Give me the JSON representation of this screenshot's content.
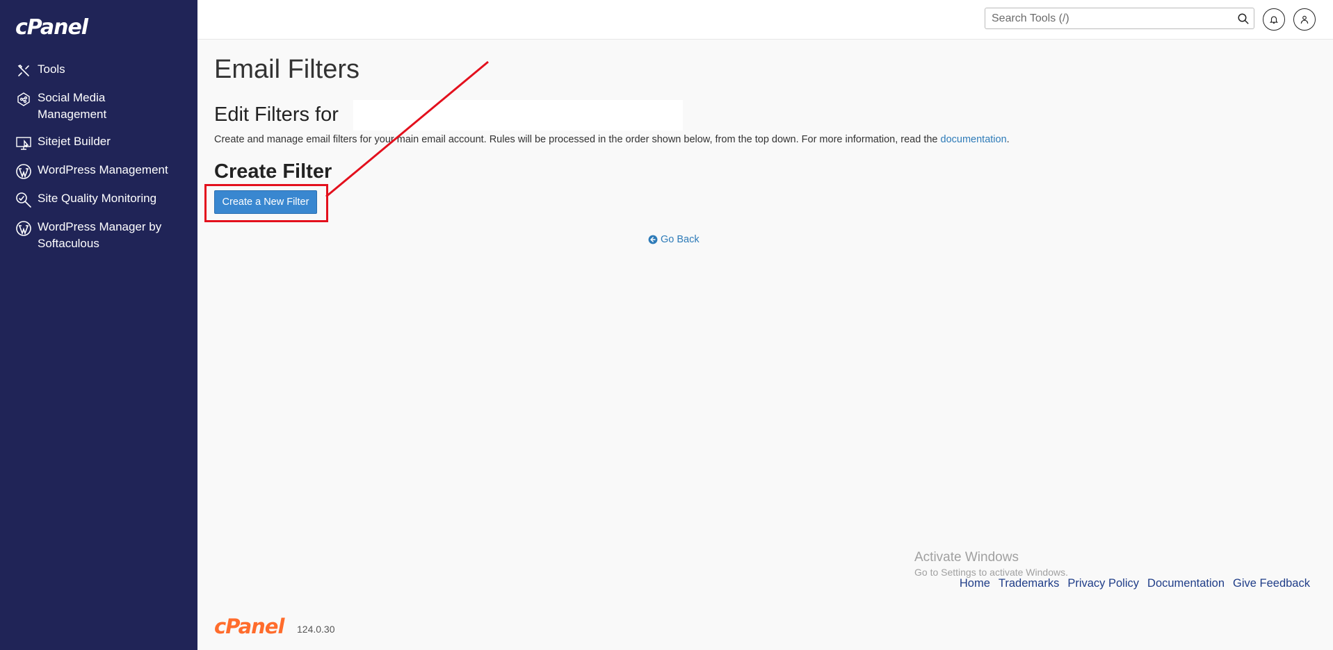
{
  "brand": {
    "logo_text": "cPanel",
    "version": "124.0.30"
  },
  "sidebar": {
    "items": [
      {
        "label": "Tools",
        "icon": "tools-icon"
      },
      {
        "label": "Social Media Management",
        "icon": "social-media-icon"
      },
      {
        "label": "Sitejet Builder",
        "icon": "sitejet-icon"
      },
      {
        "label": "WordPress Management",
        "icon": "wordpress-icon"
      },
      {
        "label": "Site Quality Monitoring",
        "icon": "magnifier-icon"
      },
      {
        "label": "WordPress Manager by Softaculous",
        "icon": "wordpress-icon"
      }
    ]
  },
  "header": {
    "search_placeholder": "Search Tools (/)"
  },
  "main": {
    "page_title": "Email Filters",
    "edit_title": "Edit Filters for",
    "description": "Create and manage email filters for your main email account. Rules will be processed in the order shown below, from the top down. For more information, read the ",
    "doc_link": "documentation",
    "period": ".",
    "create_title": "Create Filter",
    "create_button": "Create a New Filter",
    "go_back": "Go Back"
  },
  "footer": {
    "links": [
      "Home",
      "Trademarks",
      "Privacy Policy",
      "Documentation",
      "Give Feedback"
    ]
  },
  "watermark": {
    "line1": "Activate Windows",
    "line2": "Go to Settings to activate Windows."
  },
  "colors": {
    "sidebar_bg": "#202457",
    "button_bg": "#3987d0",
    "link": "#2e7bb8",
    "highlight": "#e3101d",
    "footer_logo": "#ff6c2c"
  }
}
